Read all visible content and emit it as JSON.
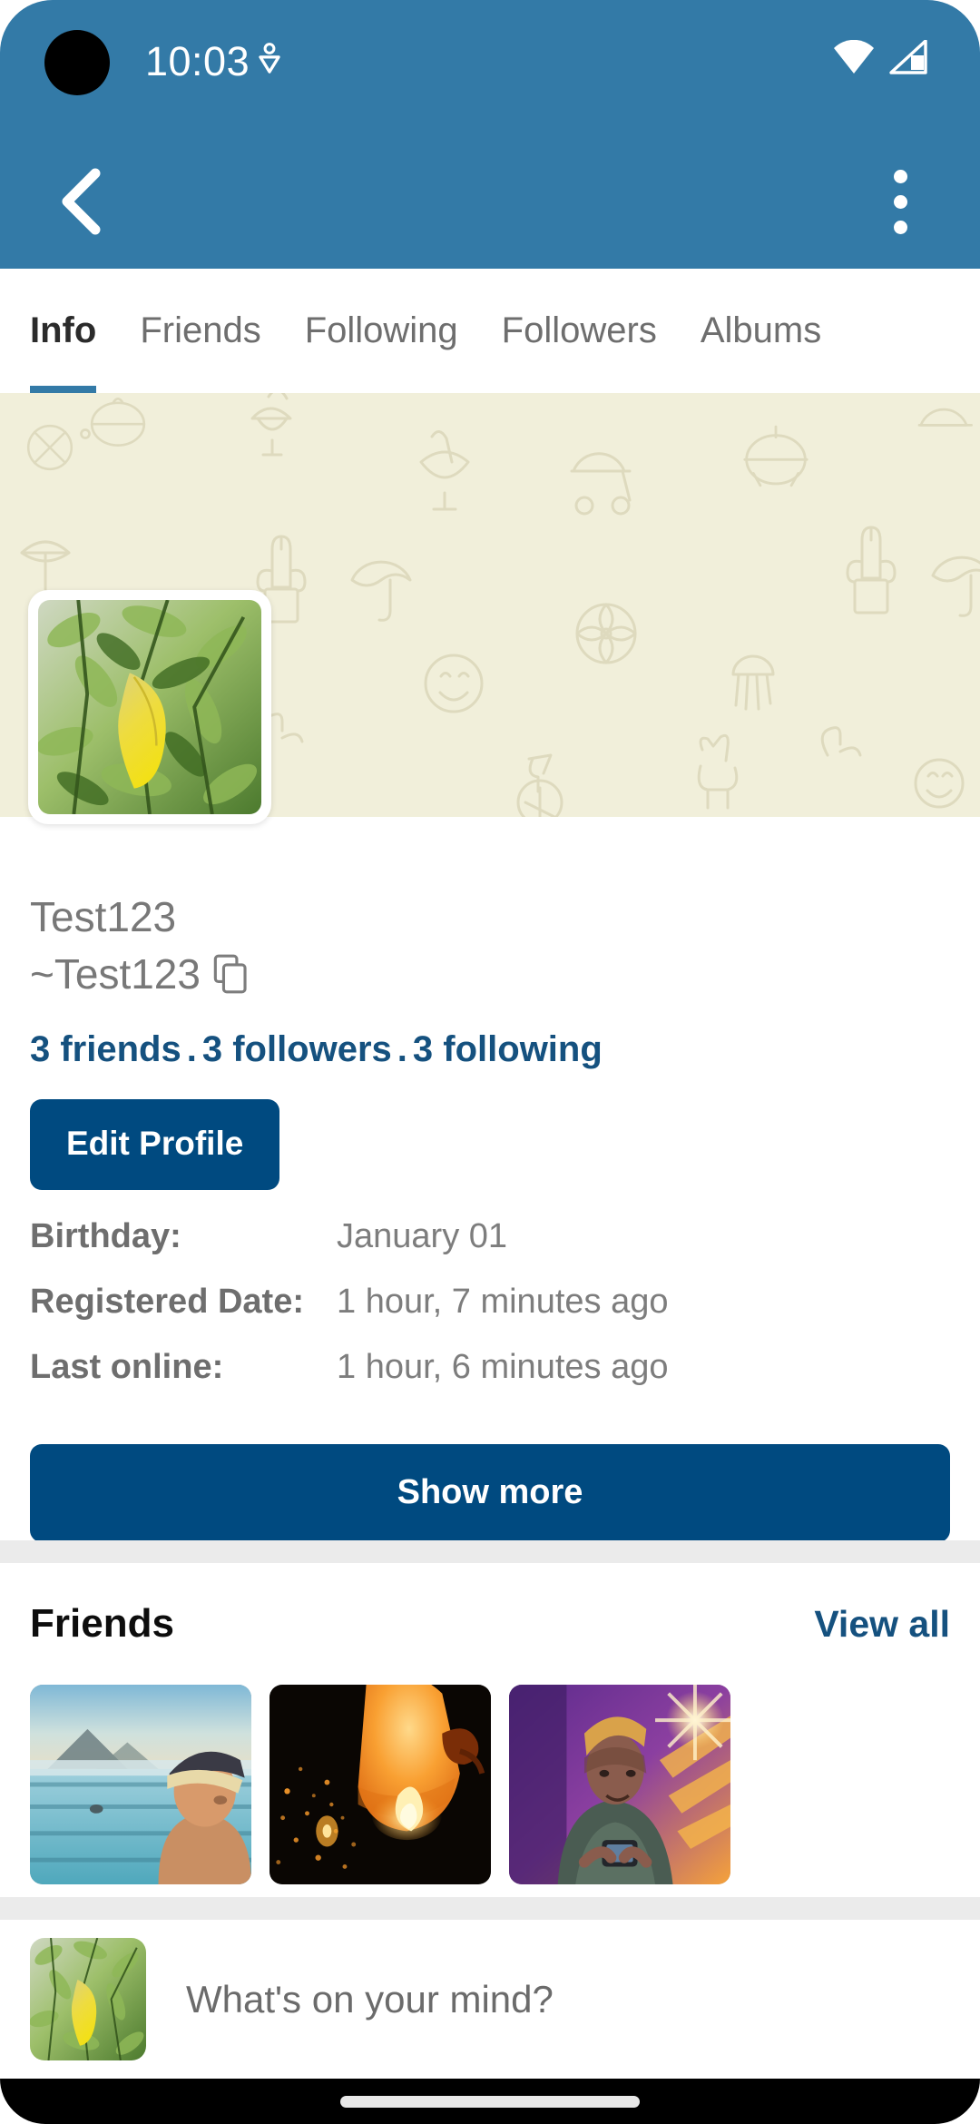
{
  "status_bar": {
    "time": "10:03",
    "icons": [
      "location-icon",
      "wifi-icon",
      "cellular-signal-icon"
    ]
  },
  "app_bar": {
    "back_icon": "back-chevron-icon",
    "overflow_icon": "more-vertical-icon",
    "background_color": "#337AA7"
  },
  "tabs": [
    {
      "label": "Info",
      "active": true
    },
    {
      "label": "Friends",
      "active": false
    },
    {
      "label": "Following",
      "active": false
    },
    {
      "label": "Followers",
      "active": false
    },
    {
      "label": "Albums",
      "active": false
    }
  ],
  "cover": {
    "background_color": "#F1EFDA",
    "pattern": "doodle-outline-icons"
  },
  "profile": {
    "avatar_alt": "green-leaves-with-yellow-leaf",
    "display_name": "Test123",
    "handle": "~Test123",
    "copy_icon": "copy-icon",
    "stats": {
      "friends": "3 friends",
      "followers": "3 followers",
      "following": "3 following",
      "separator": "."
    },
    "edit_profile_label": "Edit Profile",
    "info_rows": [
      {
        "label": "Birthday:",
        "value": "January 01"
      },
      {
        "label": "Registered Date:",
        "value": "1 hour, 7 minutes ago"
      },
      {
        "label": "Last online:",
        "value": "1 hour, 6 minutes ago"
      }
    ],
    "show_more_label": "Show more"
  },
  "friends_section": {
    "title": "Friends",
    "view_all_label": "View all",
    "thumbnails": [
      {
        "alt": "man-at-beach-with-cap"
      },
      {
        "alt": "orange-sky-lantern-at-night"
      },
      {
        "alt": "man-in-purple-orange-sunlight"
      }
    ]
  },
  "composer": {
    "avatar_alt": "green-leaves-with-yellow-leaf",
    "placeholder": "What's on your mind?"
  },
  "colors": {
    "app_bar_blue": "#337AA7",
    "primary_button": "#004A80",
    "link_blue": "#15517F",
    "divider_gray": "#EBEBEB",
    "cover_cream": "#F1EFDA"
  }
}
